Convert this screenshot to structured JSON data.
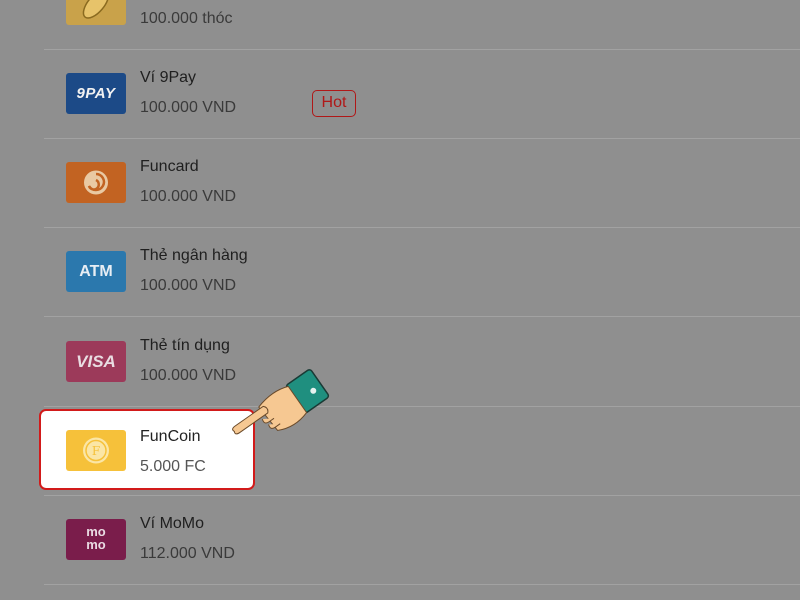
{
  "payment_methods": [
    {
      "name": "",
      "amount": "100.000 thóc",
      "icon": "rice-grain-icon"
    },
    {
      "name": "Ví 9Pay",
      "amount": "100.000 VND",
      "icon": "9pay-logo-icon",
      "icon_text": "9PAY",
      "badge": "Hot"
    },
    {
      "name": "Funcard",
      "amount": "100.000 VND",
      "icon": "funcard-logo-icon"
    },
    {
      "name": "Thẻ ngân hàng",
      "amount": "100.000 VND",
      "icon": "atm-card-icon",
      "icon_text": "ATM"
    },
    {
      "name": "Thẻ tín dụng",
      "amount": "100.000 VND",
      "icon": "visa-card-icon",
      "icon_text": "VISA"
    },
    {
      "name": "FunCoin",
      "amount": "5.000 FC",
      "icon": "funcoin-icon",
      "selected": true
    },
    {
      "name": "Ví MoMo",
      "amount": "112.000 VND",
      "icon": "momo-logo-icon",
      "icon_text": "mo\nmo"
    }
  ],
  "colors": {
    "overlay": "#8f8f8f",
    "highlight_border": "#d21a1a",
    "badge": "#b01818"
  }
}
